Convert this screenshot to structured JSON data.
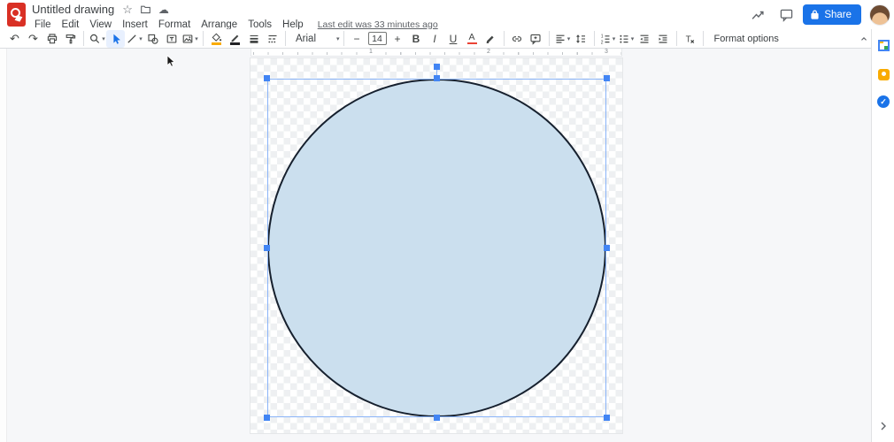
{
  "header": {
    "app": "Google Drawings",
    "title": "Untitled drawing",
    "menu": [
      "File",
      "Edit",
      "View",
      "Insert",
      "Format",
      "Arrange",
      "Tools",
      "Help"
    ],
    "last_edit": "Last edit was 33 minutes ago",
    "share": "Share"
  },
  "toolbar": {
    "font_family": "Arial",
    "font_size": "14",
    "minus": "−",
    "plus": "+",
    "bold": "B",
    "italic": "I",
    "underline": "U",
    "text_color_letter": "A",
    "format_options": "Format options"
  },
  "ruler": {
    "labels": [
      "1",
      "2",
      "3"
    ]
  },
  "canvas": {
    "background": "transparent-checkerboard",
    "shape": {
      "type": "ellipse",
      "selected": true,
      "fill": "#cbdfee",
      "border": "#16202e"
    }
  },
  "icons": {
    "star": "☆",
    "cloud": "☁",
    "undo": "↶",
    "redo": "↷",
    "caret": "▾",
    "tasks_check": "✓",
    "chevron_right": "›"
  },
  "side_panel": {
    "items": [
      "google-calendar",
      "google-keep",
      "google-tasks"
    ]
  },
  "colors": {
    "accent": "#1a73e8",
    "toolbar-icon": "#444746",
    "active-tool-bg": "#e8f0fe",
    "selection": "#8ab4f8",
    "handle": "#4285f4",
    "shape-fill": "#cbdfee",
    "shape-border": "#16202e",
    "fill-swatch": "#f9ab00",
    "border-swatch": "#202124",
    "text-color-swatch": "#ea4335"
  }
}
